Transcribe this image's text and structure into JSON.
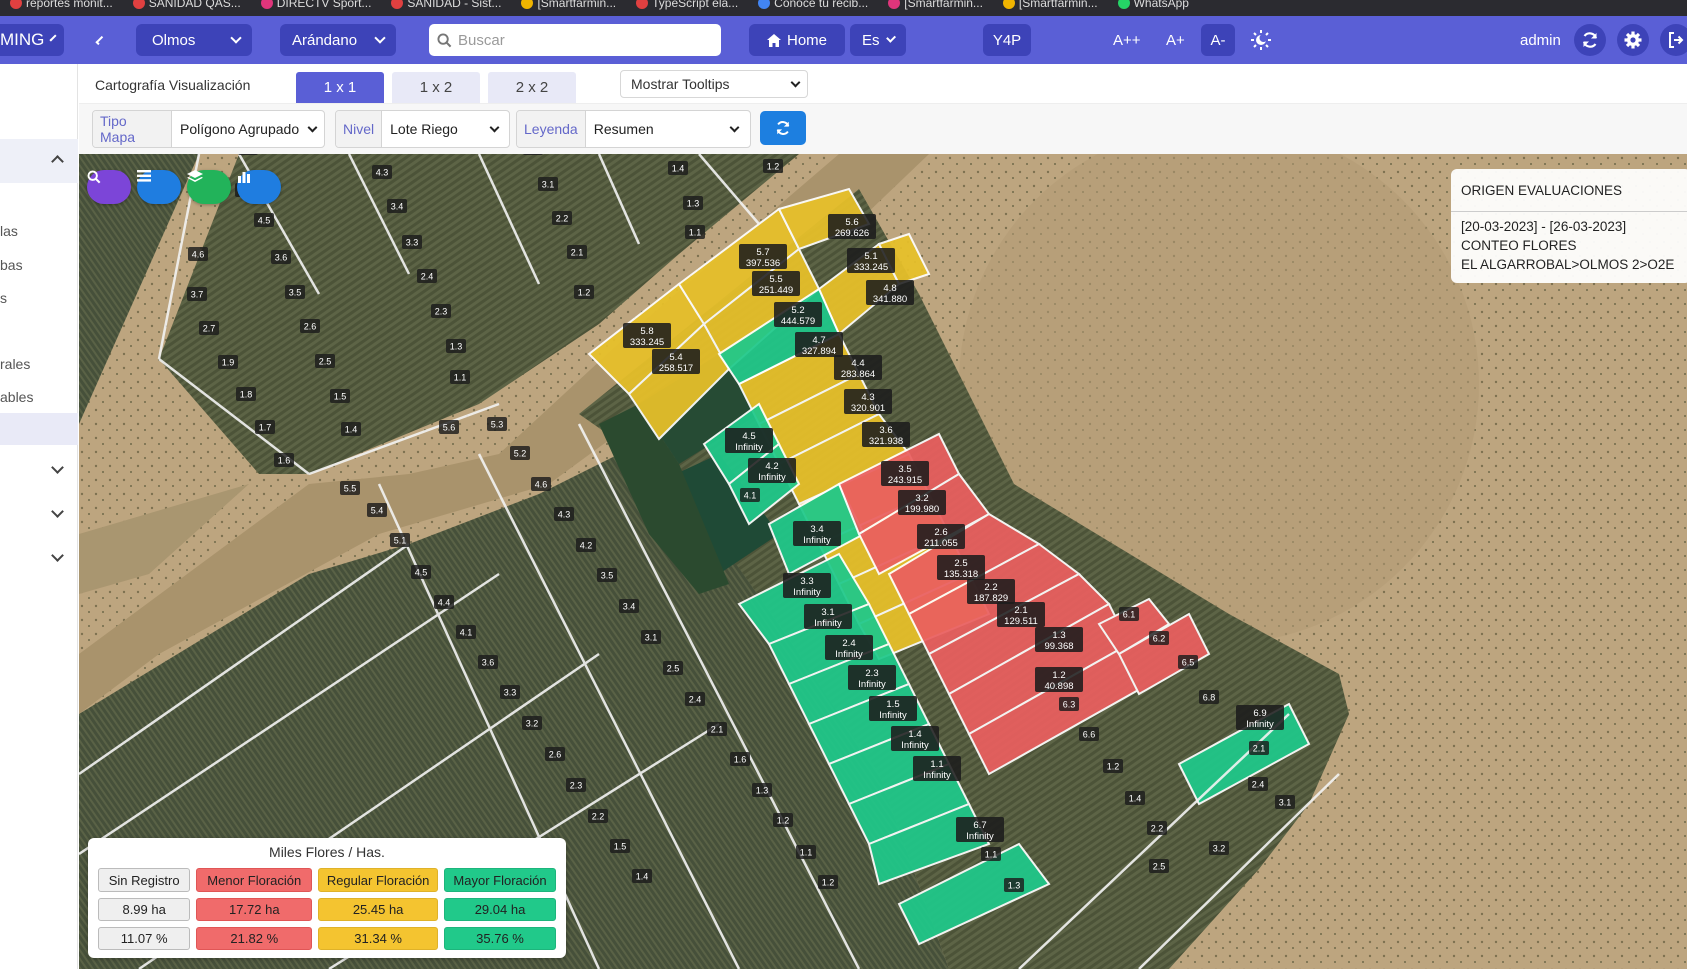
{
  "browser": {
    "bookmarks": [
      {
        "label": "reportes monit...",
        "icon": "red-round-icon",
        "color": "#e04040"
      },
      {
        "label": "SANIDAD QAS...",
        "icon": "red-round-icon",
        "color": "#e04040"
      },
      {
        "label": "DIRECTV Sport...",
        "icon": "pink-round-icon",
        "color": "#e0357b"
      },
      {
        "label": "SANIDAD - Sist...",
        "icon": "red-round-icon",
        "color": "#e04040"
      },
      {
        "label": "[Smartfarmin...",
        "icon": "windows-icon",
        "color": "#f0b400"
      },
      {
        "label": "TypeScript ela...",
        "icon": "red-round-icon",
        "color": "#e04040"
      },
      {
        "label": "Conoce tu recib...",
        "icon": "g-icon",
        "color": "#4285f4"
      },
      {
        "label": "[Smartfarmin...",
        "icon": "play-icon",
        "color": "#e0357b"
      },
      {
        "label": "[Smartfarmin...",
        "icon": "windows-icon",
        "color": "#f0b400"
      },
      {
        "label": "WhatsApp",
        "icon": "whatsapp-icon",
        "color": "#25d366"
      }
    ]
  },
  "topbar": {
    "brand": "MING",
    "farm": "Olmos",
    "crop": "Arándano",
    "search_placeholder": "Buscar",
    "home": "Home",
    "lang": "Es",
    "y4p": "Y4P",
    "font_large": "A++",
    "font_medium": "A+",
    "font_small": "A-",
    "user": "admin"
  },
  "sidebar": {
    "items": [
      "las",
      "bas",
      "s",
      "rales",
      "ables"
    ]
  },
  "tabsbar": {
    "title": "Cartografía Visualización",
    "tabs": [
      "1 x 1",
      "1 x 2",
      "2 x 2"
    ],
    "active_tab": "1 x 1",
    "tooltips": "Mostrar Tooltips"
  },
  "filters": {
    "map_type_label": "Tipo Mapa",
    "map_type_value": "Polígono Agrupado",
    "level_label": "Nivel",
    "level_value": "Lote Riego",
    "legend_label": "Leyenda",
    "legend_value": "Resumen"
  },
  "colors": {
    "accent": "#5a5fd6",
    "low": "#f06b6b",
    "regular": "#f4c430",
    "high": "#21c98a",
    "none": "#efefef"
  },
  "origin_panel": {
    "title": "ORIGEN EVALUACIONES",
    "range": "[20-03-2023] - [26-03-2023]",
    "evaluation": "CONTEO FLORES",
    "location": "EL ALGARROBAL>OLMOS 2>O2E"
  },
  "legend": {
    "title": "Miles Flores / Has.",
    "categories": [
      "Sin Registro",
      "Menor Floración",
      "Regular Floración",
      "Mayor Floración"
    ],
    "areas": [
      "8.99 ha",
      "17.72 ha",
      "25.45 ha",
      "29.04 ha"
    ],
    "percents": [
      "11.07 %",
      "21.82 %",
      "31.34 %",
      "35.76 %"
    ]
  },
  "lot_labels": [
    {
      "id": "5.6",
      "value": "269.626",
      "cls": "regular"
    },
    {
      "id": "5.7",
      "value": "397.536",
      "cls": "regular"
    },
    {
      "id": "5.1",
      "value": "333.245",
      "cls": "regular"
    },
    {
      "id": "5.5",
      "value": "251.449",
      "cls": "regular"
    },
    {
      "id": "4.8",
      "value": "341.880",
      "cls": "regular"
    },
    {
      "id": "5.2",
      "value": "444.579",
      "cls": "regular"
    },
    {
      "id": "5.8",
      "value": "333.245",
      "cls": "regular"
    },
    {
      "id": "4.7",
      "value": "327.894",
      "cls": "regular"
    },
    {
      "id": "5.4",
      "value": "258.517",
      "cls": "regular"
    },
    {
      "id": "4.4",
      "value": "283.864",
      "cls": "regular"
    },
    {
      "id": "4.3",
      "value": "320.901",
      "cls": "regular"
    },
    {
      "id": "3.6",
      "value": "321.938",
      "cls": "regular"
    },
    {
      "id": "4.5",
      "value": "Infinity",
      "cls": "high"
    },
    {
      "id": "4.2",
      "value": "Infinity",
      "cls": "high"
    },
    {
      "id": "3.5",
      "value": "243.915",
      "cls": "regular"
    },
    {
      "id": "3.2",
      "value": "199.980",
      "cls": "low"
    },
    {
      "id": "3.4",
      "value": "Infinity",
      "cls": "high"
    },
    {
      "id": "2.6",
      "value": "211.055",
      "cls": "regular"
    },
    {
      "id": "2.5",
      "value": "135.318",
      "cls": "low"
    },
    {
      "id": "3.3",
      "value": "Infinity",
      "cls": "high"
    },
    {
      "id": "2.2",
      "value": "187.829",
      "cls": "low"
    },
    {
      "id": "3.1",
      "value": "Infinity",
      "cls": "high"
    },
    {
      "id": "2.1",
      "value": "129.511",
      "cls": "low"
    },
    {
      "id": "2.4",
      "value": "Infinity",
      "cls": "high"
    },
    {
      "id": "1.3",
      "value": "99.368",
      "cls": "low"
    },
    {
      "id": "2.3",
      "value": "Infinity",
      "cls": "high"
    },
    {
      "id": "1.2",
      "value": "40.898",
      "cls": "low"
    },
    {
      "id": "1.5",
      "value": "Infinity",
      "cls": "high"
    },
    {
      "id": "1.4",
      "value": "Infinity",
      "cls": "high"
    },
    {
      "id": "1.1",
      "value": "Infinity",
      "cls": "high"
    },
    {
      "id": "6.9",
      "value": "Infinity",
      "cls": "high"
    },
    {
      "id": "6.7",
      "value": "Infinity",
      "cls": "high"
    }
  ],
  "plain_labels": [
    "5.1",
    "3.2",
    "1.4",
    "1.2",
    "4.3",
    "3.1",
    "1.3",
    "4.7",
    "3.4",
    "2.2",
    "1.1",
    "4.5",
    "4.6",
    "3.6",
    "3.3",
    "2.1",
    "3.7",
    "3.5",
    "2.4",
    "1.2",
    "2.7",
    "2.6",
    "2.3",
    "1.9",
    "2.5",
    "1.3",
    "1.8",
    "1.5",
    "1.1",
    "1.7",
    "1.4",
    "5.6",
    "5.3",
    "1.6",
    "5.2",
    "5.5",
    "4.6",
    "5.4",
    "4.3",
    "4.1",
    "5.1",
    "4.2",
    "4.5",
    "3.5",
    "4.4",
    "3.4",
    "4.1",
    "3.1",
    "3.6",
    "2.5",
    "3.3",
    "2.4",
    "3.2",
    "2.1",
    "2.6",
    "1.6",
    "2.3",
    "1.3",
    "2.2",
    "1.2",
    "1.5",
    "1.1",
    "1.4",
    "1.2",
    "6.1",
    "6.2",
    "6.5",
    "6.8",
    "6.3",
    "6.6",
    "2.1",
    "1.2",
    "2.4",
    "1.4",
    "3.1",
    "2.2",
    "3.2",
    "1.1",
    "2.5",
    "1.3"
  ]
}
